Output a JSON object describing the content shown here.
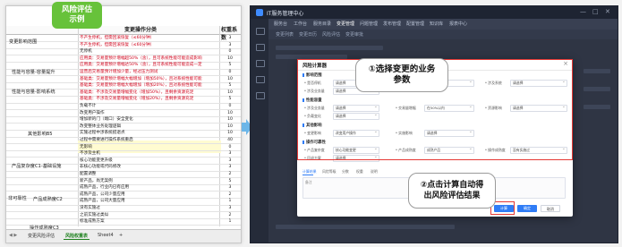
{
  "sheet": {
    "badge": [
      "风险评估",
      "示例"
    ],
    "col_headers": {
      "op": "变更操作分类",
      "weight": "权重系数"
    },
    "categories": [
      "变更影响范围",
      "性能与容量-容量提升",
      "性能与容量-影响系统",
      "其他影响B5",
      "产品复杂度C1-基础设施",
      "产品成熟度C2",
      "非可靠性",
      "操作成熟度C3"
    ],
    "rows": [
      {
        "text": "不产生停机，但需回滚恢复（≤60分钟）",
        "weight": "3",
        "red": true
      },
      {
        "text": "不产生停机，但需回滚恢复（≤60分钟）",
        "weight": "3",
        "red": true
      },
      {
        "text": "无停机",
        "weight": "0",
        "red": false
      },
      {
        "text": "应用类：交易量预计增幅超50%（含），且可系统性能可能造成影响",
        "weight": "10",
        "red": true
      },
      {
        "text": "应用类：交易量预计增幅达50%（含），且可系统性能可能造成一定",
        "weight": "5",
        "red": true
      },
      {
        "text": "运营后交易量预计增加少量，经过压力测试",
        "weight": "0",
        "red": true
      },
      {
        "text": "基础类：交易量预计增幅大幅增加（增加50%），且对系统性能可能",
        "weight": "10",
        "red": true
      },
      {
        "text": "基础类：交易量预计增幅大幅增加（增加20%），且对系统性能可能",
        "weight": "5",
        "red": true
      },
      {
        "text": "基础类：不涉及交易量增幅变化（增加50%），且剩余资源充足",
        "weight": "10",
        "red": true
      },
      {
        "text": "基础类：不涉及交易量增幅变化（增加20%），且剩余资源充足",
        "weight": "5",
        "red": true
      },
      {
        "text": "负载不计",
        "weight": "0",
        "red": false
      },
      {
        "text": "改变用户操作",
        "weight": "10",
        "red": false
      },
      {
        "text": "增加新的门（端口）安全变化",
        "weight": "10",
        "red": false
      },
      {
        "text": "改变整体业务处理逻辑",
        "weight": "10",
        "red": false
      },
      {
        "text": "实施过程中涉系统搭退点",
        "weight": "10",
        "red": false
      },
      {
        "text": "过程中需要进行操作系统重启",
        "weight": "40",
        "red": false
      },
      {
        "text": "无影响",
        "weight": "0",
        "red": false
      },
      {
        "text": "不涉及主机",
        "weight": "3",
        "red": false
      },
      {
        "text": "核心功能变更升级",
        "weight": "3",
        "red": false
      },
      {
        "text": "非核心功能或代码修改",
        "weight": "3",
        "red": false
      },
      {
        "text": "配置调整",
        "weight": "2",
        "red": false
      },
      {
        "text": "新产品，尚无案例",
        "weight": "5",
        "red": false
      },
      {
        "text": "成熟产品，行业内已有应用",
        "weight": "3",
        "red": false
      },
      {
        "text": "成熟产品，公司少量应用",
        "weight": "2",
        "red": false
      },
      {
        "text": "成熟产品，公司大量应用",
        "weight": "1",
        "red": false
      },
      {
        "text": "没有实施过",
        "weight": "3",
        "red": false
      },
      {
        "text": "之前实施过类似",
        "weight": "2",
        "red": false
      },
      {
        "text": "标准成熟方案",
        "weight": "1",
        "red": false
      }
    ],
    "tabs": [
      {
        "label": "变更风险评估",
        "active": false
      },
      {
        "label": "风险权重表",
        "active": true
      },
      {
        "label": "Sheet4",
        "active": false
      }
    ],
    "add_tab": "+"
  },
  "app": {
    "title": "IT服务管理中心",
    "window_controls": [
      "—",
      "□",
      "✕"
    ],
    "nav": [
      {
        "label": "服务台",
        "active": false
      },
      {
        "label": "工作台",
        "active": false
      },
      {
        "label": "服务目录",
        "active": false
      },
      {
        "label": "变更管理",
        "active": true
      },
      {
        "label": "问题管理",
        "active": false
      },
      {
        "label": "发布管理",
        "active": false
      },
      {
        "label": "配置管理",
        "active": false
      },
      {
        "label": "知识库",
        "active": false
      },
      {
        "label": "报表中心",
        "active": false
      }
    ],
    "subnav": [
      "变更列表",
      "变更日历",
      "风险评估",
      "变更审批"
    ],
    "modal": {
      "title": "风险计算器",
      "close": "×",
      "sections": [
        {
          "title": "影响范围",
          "fields": [
            {
              "label": "* 是否停机",
              "value": "请选择"
            },
            {
              "label": "* 涉及业务量",
              "value": "请选择"
            },
            {
              "label": "* 影响用户数",
              "value": "请选择"
            },
            {
              "label": "* 涉及系统",
              "value": "请选择"
            }
          ]
        },
        {
          "title": "性能容量",
          "fields": [
            {
              "label": "* 涉及业务量",
              "value": "请选择"
            },
            {
              "label": "* 交易量增幅",
              "value": "在50%以内"
            },
            {
              "label": "* 资源影响",
              "value": "请选择"
            },
            {
              "label": "* 负载变化",
              "value": "请选择"
            }
          ]
        },
        {
          "title": "其他影响",
          "fields": [
            {
              "label": "* 变更影响",
              "value": "改变用户操作"
            },
            {
              "label": "* 实施影响",
              "value": "请选择"
            }
          ]
        },
        {
          "title": "操作可靠性",
          "fields": [
            {
              "label": "* 产品复杂度",
              "value": "核心功能变更"
            },
            {
              "label": "* 产品成熟度",
              "value": "成熟产品"
            },
            {
              "label": "* 操作成熟度",
              "value": "没有实施过"
            },
            {
              "label": "* 回退方案",
              "value": "请选择"
            }
          ]
        }
      ],
      "result_tabs": [
        {
          "label": "计算结果",
          "active": true
        },
        {
          "label": "风险等级",
          "active": false
        },
        {
          "label": "分数",
          "active": false
        },
        {
          "label": "权重",
          "active": false
        },
        {
          "label": "说明",
          "active": false
        }
      ],
      "result_label": "备注",
      "buttons": {
        "calculate": "计算",
        "confirm": "确定",
        "cancel": "取消"
      }
    }
  },
  "callouts": {
    "step1": [
      "①选择变更的业务",
      "参数"
    ],
    "step2": [
      "②点击计算自动得",
      "出风险评估结果"
    ]
  },
  "colors": {
    "accent": "#2f7cf6",
    "badge": "#67c23a",
    "highlight": "#e53935",
    "arrow": "#6cb6e8"
  }
}
